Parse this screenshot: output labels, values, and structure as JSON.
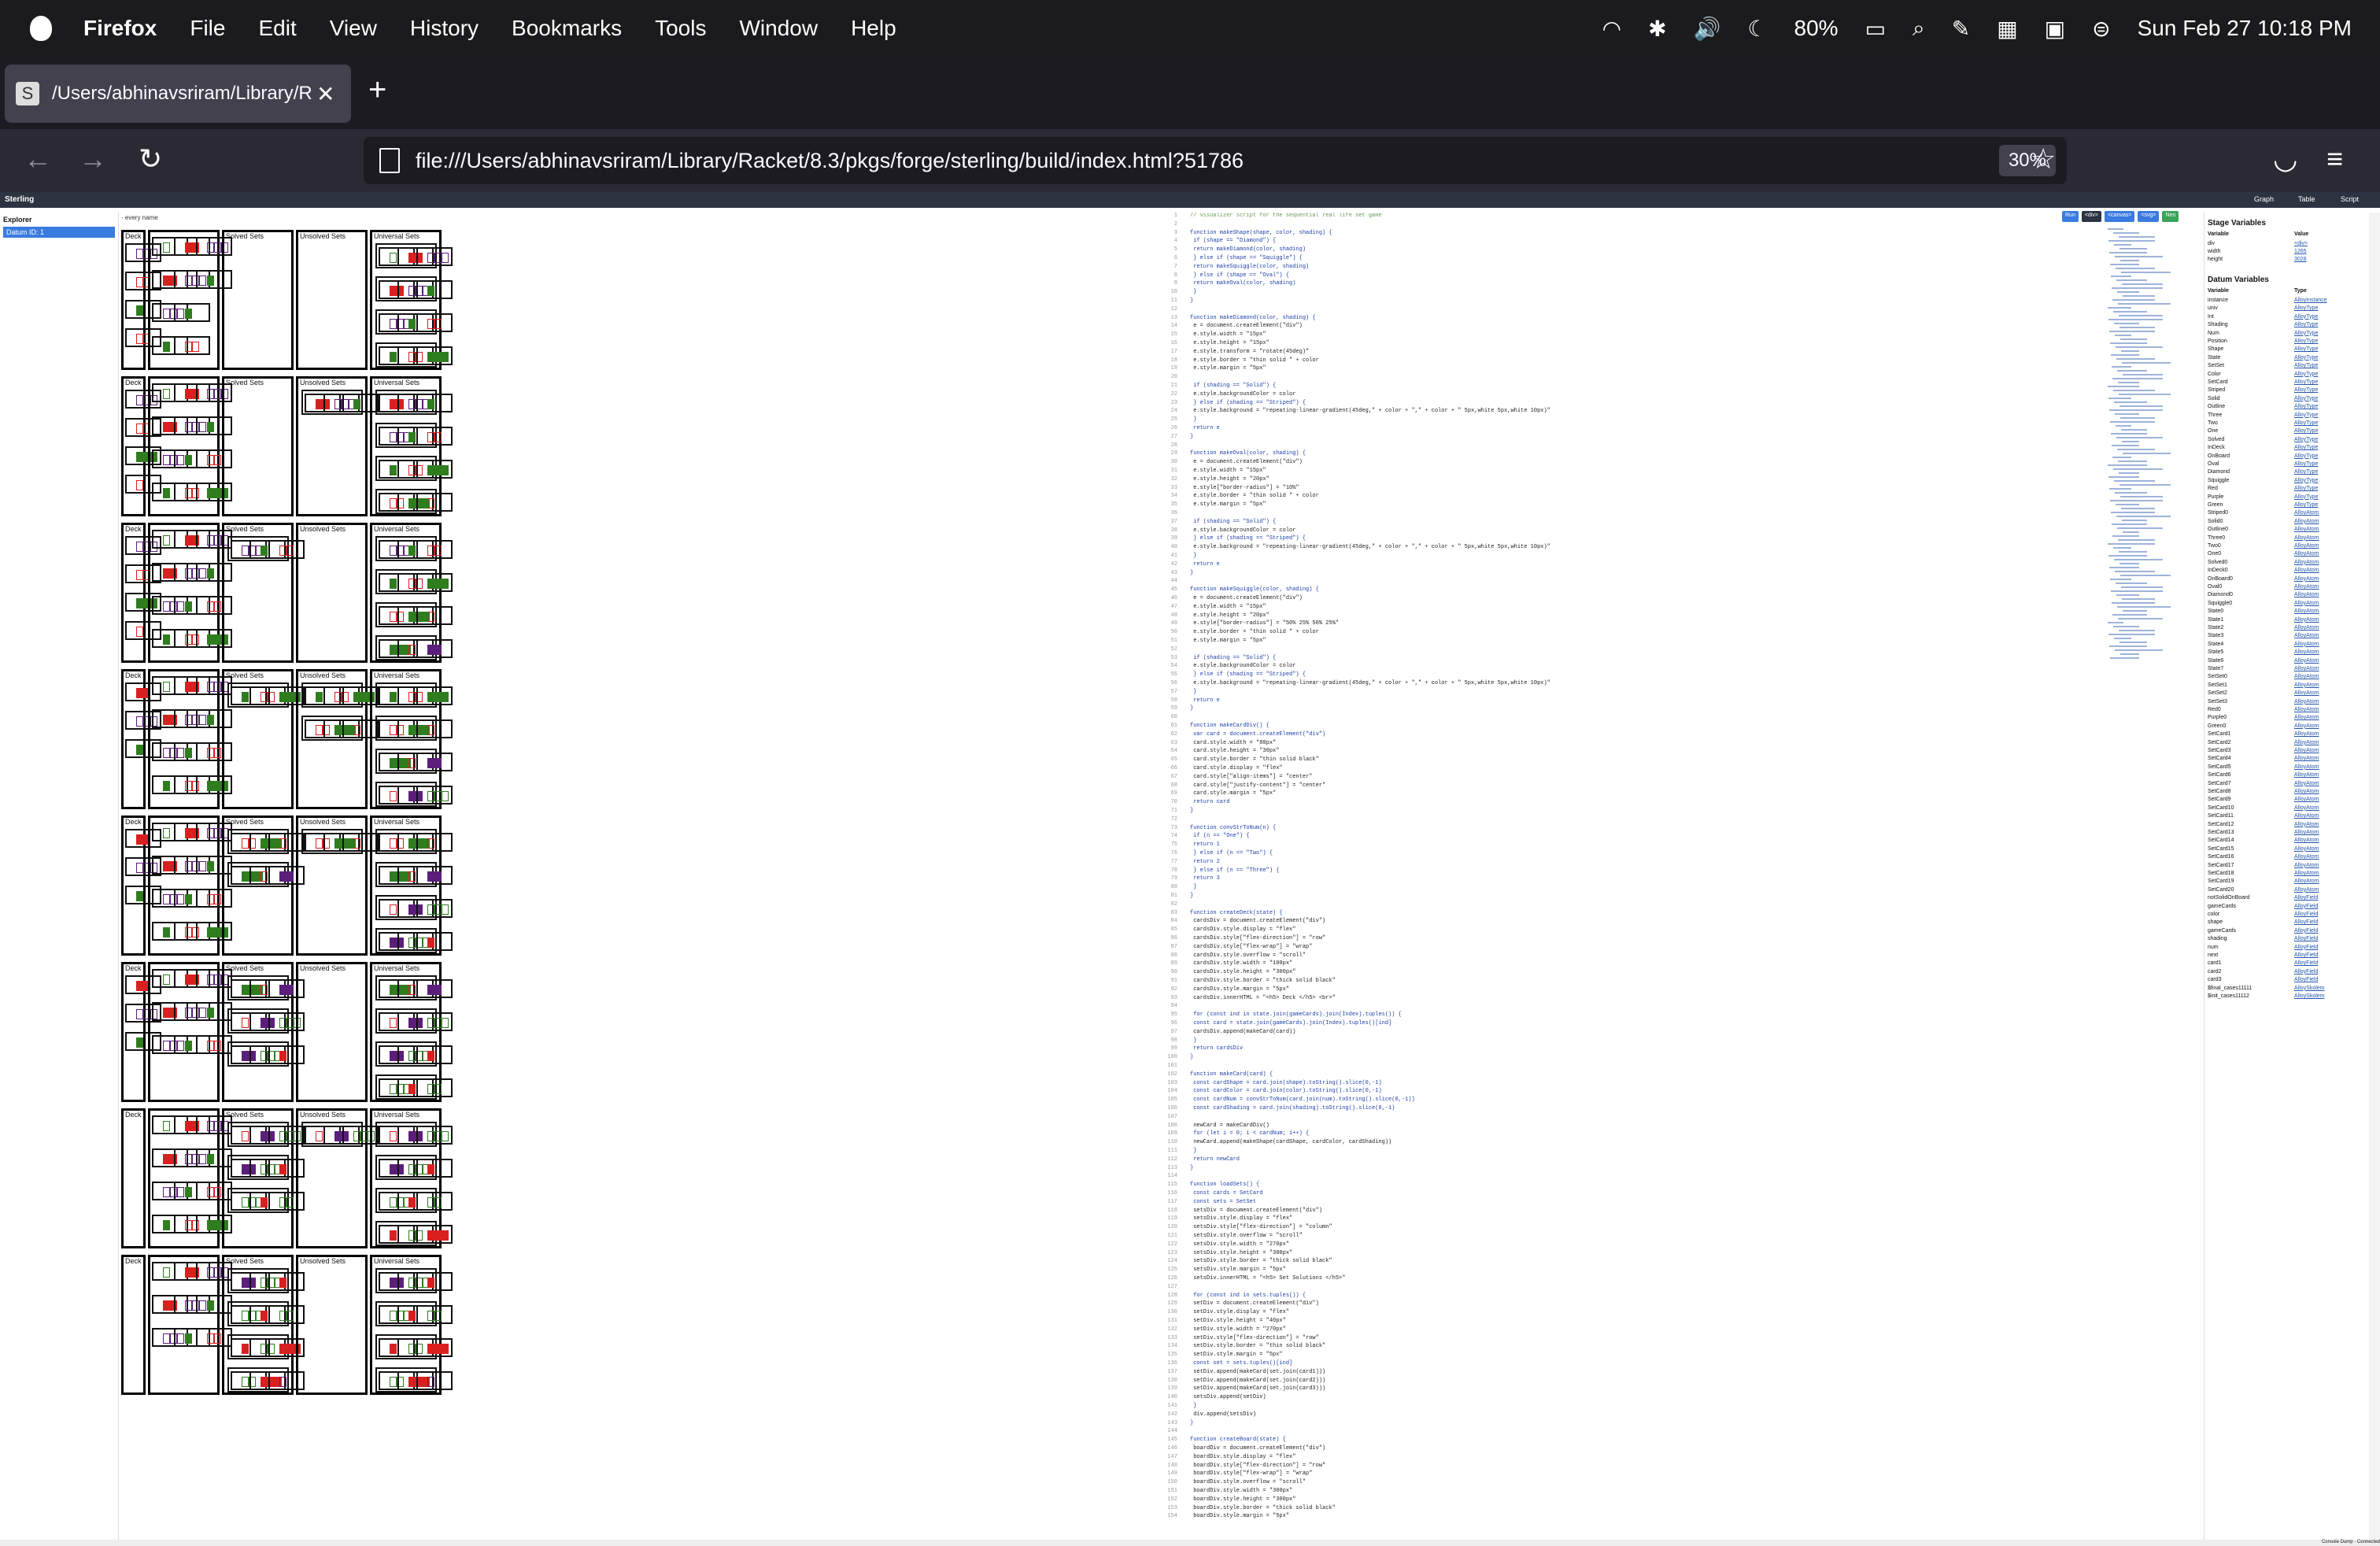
{
  "menubar": {
    "app": "Firefox",
    "items": [
      "File",
      "Edit",
      "View",
      "History",
      "Bookmarks",
      "Tools",
      "Window",
      "Help"
    ],
    "battery": "80%",
    "datetime": "Sun Feb 27  10:18 PM"
  },
  "tab": {
    "title": "/Users/abhinavsriram/Library/Ra",
    "favicon": "S"
  },
  "nav": {
    "url": "file:///Users/abhinavsriram/Library/Racket/8.3/pkgs/forge/sterling/build/index.html?51786",
    "zoom": "30%"
  },
  "sterling": {
    "brand": "Sterling",
    "views": [
      "Graph",
      "Table",
      "Script"
    ],
    "explorer_title": "Explorer",
    "datum": "Datum ID: 1",
    "viz_header": "· every name",
    "panel_labels": [
      "Deck",
      "Solved Sets",
      "Unsolved Sets",
      "Universal Sets"
    ],
    "run_buttons": [
      "Run",
      "<div>",
      "<canvas>",
      "<svg>",
      "Neo"
    ],
    "colors": {
      "green": "#2f7d1f",
      "red": "#d92020",
      "purple": "#5b1e7a",
      "run": "#3a7be0"
    },
    "rows": [
      {
        "deck": [
          2,
          3,
          1,
          1
        ],
        "board": [
          3,
          3,
          2,
          2
        ],
        "solved": 0,
        "unsolved": 0
      },
      {
        "deck": [
          2,
          3,
          3,
          3
        ],
        "board": [
          3,
          3,
          3,
          3
        ],
        "solved": 0,
        "unsolved": 1
      },
      {
        "deck": [
          2,
          3,
          3,
          3
        ],
        "board": [
          3,
          3,
          3,
          3
        ],
        "solved": 1,
        "unsolved": 0
      },
      {
        "deck": [
          1,
          1,
          1,
          0
        ],
        "board": [
          3,
          3,
          3,
          3
        ],
        "solved": 1,
        "unsolved": 2
      },
      {
        "deck": [
          1,
          1,
          1,
          0
        ],
        "board": [
          3,
          3,
          3,
          3
        ],
        "solved": 2,
        "unsolved": 1
      },
      {
        "deck": [
          1,
          1,
          1,
          0
        ],
        "board": [
          3,
          3,
          3,
          0
        ],
        "solved": 3,
        "unsolved": 0
      },
      {
        "deck": [
          0,
          0,
          0,
          0
        ],
        "board": [
          3,
          3,
          3,
          3
        ],
        "solved": 3,
        "unsolved": 1
      },
      {
        "deck": [
          0,
          0,
          0,
          0
        ],
        "board": [
          3,
          3,
          3,
          0
        ],
        "solved": 4,
        "unsolved": 0
      }
    ]
  },
  "code_lines": [
    "// visualizer script for the sequential real life set game",
    "",
    "function makeShape(shape, color, shading) {",
    "    if (shape == \"Diamond\") {",
    "        return makeDiamond(color, shading)",
    "    } else if (shape == \"Squiggle\") {",
    "        return makeSquiggle(color, shading)",
    "    } else if (shape == \"Oval\") {",
    "        return makeOval(color, shading)",
    "    }",
    "}",
    "",
    "function makeDiamond(color, shading) {",
    "    e = document.createElement(\"div\")",
    "    e.style.width = \"15px\"",
    "    e.style.height = \"15px\"",
    "    e.style.transform = \"rotate(45deg)\"",
    "    e.style.border = \"thin solid \" + color",
    "    e.style.margin = \"5px\"",
    "",
    "    if (shading == \"Solid\") {",
    "        e.style.backgroundColor = color",
    "    } else if (shading == \"Striped\") {",
    "        e.style.background = \"repeating-linear-gradient(45deg,\" + color + \",\" + color + \" 5px,white 5px,white 10px)\"",
    "    }",
    "    return e",
    "}",
    "",
    "function makeOval(color, shading) {",
    "    e = document.createElement(\"div\")",
    "    e.style.width = \"15px\"",
    "    e.style.height = \"20px\"",
    "    e.style[\"border-radius\"] = \"10%\"",
    "    e.style.border = \"thin solid \" + color",
    "    e.style.margin = \"5px\"",
    "",
    "    if (shading == \"Solid\") {",
    "        e.style.backgroundColor = color",
    "    } else if (shading == \"Striped\") {",
    "        e.style.background = \"repeating-linear-gradient(45deg,\" + color + \",\" + color + \" 5px,white 5px,white 10px)\"",
    "    }",
    "    return e",
    "}",
    "",
    "function makeSquiggle(color, shading) {",
    "    e = document.createElement(\"div\")",
    "    e.style.width = \"15px\"",
    "    e.style.height = \"20px\"",
    "    e.style[\"border-radius\"] = \"50% 25% 50% 25%\"",
    "    e.style.border = \"thin solid \" + color",
    "    e.style.margin = \"5px\"",
    "",
    "    if (shading == \"Solid\") {",
    "        e.style.backgroundColor = color",
    "    } else if (shading == \"Striped\") {",
    "        e.style.background = \"repeating-linear-gradient(45deg,\" + color + \",\" + color + \" 5px,white 5px,white 10px)\"",
    "    }",
    "    return e",
    "}",
    "",
    "function makeCardDiv() {",
    "    var card = document.createElement(\"div\")",
    "    card.style.width = \"80px\"",
    "    card.style.height = \"30px\"",
    "    card.style.border = \"thin solid black\"",
    "    card.style.display = \"flex\"",
    "    card.style[\"align-items\"] = \"center\"",
    "    card.style[\"justify-content\"] = \"center\"",
    "    card.style.margin = \"5px\"",
    "    return card",
    "}",
    "",
    "function convStrToNum(n) {",
    "    if (n == \"One\") {",
    "        return 1",
    "    } else if (n == \"Two\") {",
    "        return 2",
    "    } else if (n == \"Three\") {",
    "        return 3",
    "    }",
    "}",
    "",
    "function createDeck(state) {",
    "    cardsDiv = document.createElement(\"div\")",
    "    cardsDiv.style.display = \"flex\"",
    "    cardsDiv.style[\"flex-direction\"] = \"row\"",
    "    cardsDiv.style[\"flex-wrap\"] = \"wrap\"",
    "    cardsDiv.style.overflow = \"scroll\"",
    "    cardsDiv.style.width = \"100px\"",
    "    cardsDiv.style.height = \"300px\"",
    "    cardsDiv.style.border = \"thick solid black\"",
    "    cardsDiv.style.margin = \"5px\"",
    "    cardsDiv.innerHTML = \"<h5> Deck </h5> <br>\"",
    "",
    "    for (const ind in state.join(gameCards).join(Index).tuples()) {",
    "        const card = state.join(gameCards).join(Index).tuples()[ind]",
    "        cardsDiv.append(makeCard(card))",
    "    }",
    "    return cardsDiv",
    "}",
    "",
    "function makeCard(card) {",
    "    const cardShape = card.join(shape).toString().slice(0,-1)",
    "    const cardColor = card.join(color).toString().slice(0,-1)",
    "    const cardNum = convStrToNum(card.join(num).toString().slice(0,-1))",
    "    const cardShading = card.join(shading).toString().slice(0,-1)",
    "",
    "    newCard = makeCardDiv()",
    "    for (let i = 0; i < cardNum; i++) {",
    "        newCard.append(makeShape(cardShape, cardColor, cardShading))",
    "    }",
    "    return newCard",
    "}",
    "",
    "function loadSets() {",
    "    const cards = SetCard",
    "    const sets = SetSet",
    "    setsDiv = document.createElement(\"div\")",
    "    setsDiv.style.display = \"flex\"",
    "    setsDiv.style[\"flex-direction\"] = \"column\"",
    "    setsDiv.style.overflow = \"scroll\"",
    "    setsDiv.style.width = \"270px\"",
    "    setsDiv.style.height = \"300px\"",
    "    setsDiv.style.border = \"thick solid black\"",
    "    setsDiv.style.margin = \"5px\"",
    "    setsDiv.innerHTML = \"<h5> Set Solutions </h5>\"",
    "",
    "    for (const ind in sets.tuples()) {",
    "        setDiv = document.createElement(\"div\")",
    "        setDiv.style.display = \"flex\"",
    "        setDiv.style.height = \"40px\"",
    "        setDiv.style.width = \"270px\"",
    "        setDiv.style[\"flex-direction\"] = \"row\"",
    "        setDiv.style.border = \"thin solid black\"",
    "        setDiv.style.margin = \"5px\"",
    "        const set = sets.tuples()[ind]",
    "        setDiv.append(makeCard(set.join(card1)))",
    "        setDiv.append(makeCard(set.join(card2)))",
    "        setDiv.append(makeCard(set.join(card3)))",
    "        setsDiv.append(setDiv)",
    "    }",
    "    div.append(setsDiv)",
    "}",
    "",
    "function createBoard(state) {",
    "    boardDiv = document.createElement(\"div\")",
    "    boardDiv.style.display = \"flex\"",
    "    boardDiv.style[\"flex-direction\"] = \"row\"",
    "    boardDiv.style[\"flex-wrap\"] = \"wrap\"",
    "    boardDiv.style.overflow = \"scroll\"",
    "    boardDiv.style.width = \"300px\"",
    "    boardDiv.style.height = \"300px\"",
    "    boardDiv.style.border = \"thick solid black\"",
    "    boardDiv.style.margin = \"5px\""
  ],
  "vars": {
    "stage_title": "Stage Variables",
    "datum_title": "Datum Variables",
    "col_variable": "Variable",
    "col_value": "Value",
    "col_type": "Type",
    "stage": [
      [
        "div",
        "<div>"
      ],
      [
        "width",
        "1265"
      ],
      [
        "height",
        "3028"
      ]
    ],
    "datum": [
      [
        "instance",
        "AlloyInstance"
      ],
      [
        "univ",
        "AlloyType"
      ],
      [
        "Int",
        "AlloyType"
      ],
      [
        "Shading",
        "AlloyType"
      ],
      [
        "Num",
        "AlloyType"
      ],
      [
        "Position",
        "AlloyType"
      ],
      [
        "Shape",
        "AlloyType"
      ],
      [
        "State",
        "AlloyType"
      ],
      [
        "SetSet",
        "AlloyType"
      ],
      [
        "Color",
        "AlloyType"
      ],
      [
        "SetCard",
        "AlloyType"
      ],
      [
        "Striped",
        "AlloyType"
      ],
      [
        "Solid",
        "AlloyType"
      ],
      [
        "Outline",
        "AlloyType"
      ],
      [
        "Three",
        "AlloyType"
      ],
      [
        "Two",
        "AlloyType"
      ],
      [
        "One",
        "AlloyType"
      ],
      [
        "Solved",
        "AlloyType"
      ],
      [
        "InDeck",
        "AlloyType"
      ],
      [
        "OnBoard",
        "AlloyType"
      ],
      [
        "Oval",
        "AlloyType"
      ],
      [
        "Diamond",
        "AlloyType"
      ],
      [
        "Squiggle",
        "AlloyType"
      ],
      [
        "Red",
        "AlloyType"
      ],
      [
        "Purple",
        "AlloyType"
      ],
      [
        "Green",
        "AlloyType"
      ],
      [
        "Striped0",
        "AlloyAtom"
      ],
      [
        "Solid0",
        "AlloyAtom"
      ],
      [
        "Outline0",
        "AlloyAtom"
      ],
      [
        "Three0",
        "AlloyAtom"
      ],
      [
        "Two0",
        "AlloyAtom"
      ],
      [
        "One0",
        "AlloyAtom"
      ],
      [
        "Solved0",
        "AlloyAtom"
      ],
      [
        "InDeck0",
        "AlloyAtom"
      ],
      [
        "OnBoard0",
        "AlloyAtom"
      ],
      [
        "Oval0",
        "AlloyAtom"
      ],
      [
        "Diamond0",
        "AlloyAtom"
      ],
      [
        "Squiggle0",
        "AlloyAtom"
      ],
      [
        "State0",
        "AlloyAtom"
      ],
      [
        "State1",
        "AlloyAtom"
      ],
      [
        "State2",
        "AlloyAtom"
      ],
      [
        "State3",
        "AlloyAtom"
      ],
      [
        "State4",
        "AlloyAtom"
      ],
      [
        "State5",
        "AlloyAtom"
      ],
      [
        "State6",
        "AlloyAtom"
      ],
      [
        "State7",
        "AlloyAtom"
      ],
      [
        "SetSet0",
        "AlloyAtom"
      ],
      [
        "SetSet1",
        "AlloyAtom"
      ],
      [
        "SetSet2",
        "AlloyAtom"
      ],
      [
        "SetSet3",
        "AlloyAtom"
      ],
      [
        "Red0",
        "AlloyAtom"
      ],
      [
        "Purple0",
        "AlloyAtom"
      ],
      [
        "Green0",
        "AlloyAtom"
      ],
      [
        "SetCard1",
        "AlloyAtom"
      ],
      [
        "SetCard2",
        "AlloyAtom"
      ],
      [
        "SetCard3",
        "AlloyAtom"
      ],
      [
        "SetCard4",
        "AlloyAtom"
      ],
      [
        "SetCard5",
        "AlloyAtom"
      ],
      [
        "SetCard6",
        "AlloyAtom"
      ],
      [
        "SetCard7",
        "AlloyAtom"
      ],
      [
        "SetCard8",
        "AlloyAtom"
      ],
      [
        "SetCard9",
        "AlloyAtom"
      ],
      [
        "SetCard10",
        "AlloyAtom"
      ],
      [
        "SetCard11",
        "AlloyAtom"
      ],
      [
        "SetCard12",
        "AlloyAtom"
      ],
      [
        "SetCard13",
        "AlloyAtom"
      ],
      [
        "SetCard14",
        "AlloyAtom"
      ],
      [
        "SetCard15",
        "AlloyAtom"
      ],
      [
        "SetCard16",
        "AlloyAtom"
      ],
      [
        "SetCard17",
        "AlloyAtom"
      ],
      [
        "SetCard18",
        "AlloyAtom"
      ],
      [
        "SetCard19",
        "AlloyAtom"
      ],
      [
        "SetCard20",
        "AlloyAtom"
      ],
      [
        "notSolidOnBoard",
        "AlloyField"
      ],
      [
        "gameCards",
        "AlloyField"
      ],
      [
        "color",
        "AlloyField"
      ],
      [
        "shape",
        "AlloyField"
      ],
      [
        "gameCards",
        "AlloyField"
      ],
      [
        "shading",
        "AlloyField"
      ],
      [
        "num",
        "AlloyField"
      ],
      [
        "next",
        "AlloyField"
      ],
      [
        "card1",
        "AlloyField"
      ],
      [
        "card2",
        "AlloyField"
      ],
      [
        "card3",
        "AlloyField"
      ],
      [
        "$final_cases11111",
        "AlloySkolem"
      ],
      [
        "$init_cases11112",
        "AlloySkolem"
      ]
    ]
  },
  "status": "Console Dump  ·  Connected"
}
